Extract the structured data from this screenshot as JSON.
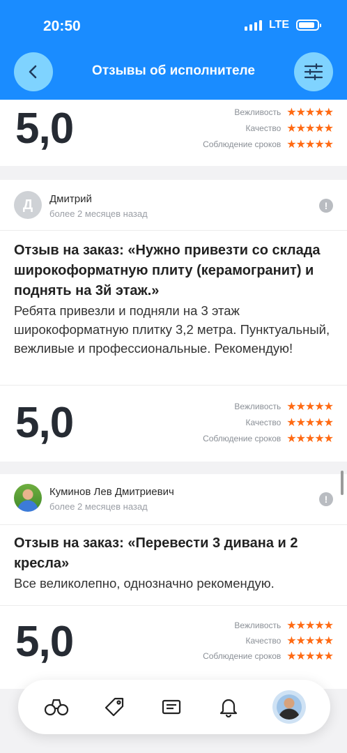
{
  "status_bar": {
    "time": "20:50",
    "network": "LTE"
  },
  "header": {
    "title": "Отзывы об исполнителе",
    "back_icon": "chevron-left-icon",
    "filter_icon": "sliders-icon"
  },
  "criteria_labels": [
    "Вежливость",
    "Качество",
    "Соблюдение сроков"
  ],
  "stars": "★★★★★",
  "accent_color": "#1a8cff",
  "star_color": "#ff6a13",
  "top_rating": {
    "score": "5,0"
  },
  "reviews": [
    {
      "avatar_letter": "Д",
      "author": "Дмитрий",
      "ago": "более 2 месяцев назад",
      "title": "Отзыв на заказ: «Нужно привезти со склада широкоформатную плиту (керамогранит) и поднять на 3й этаж.»",
      "text": "Ребята привезли и подняли на 3 этаж широкоформатную плитку 3,2 метра. Пунктуальный, вежливые и профессиональные. Рекомендую!",
      "score": "5,0"
    },
    {
      "avatar_letter": "",
      "author": "Куминов Лев Дмитриевич",
      "ago": "более 2 месяцев назад",
      "title": "Отзыв на заказ: «Перевести 3 дивана и 2 кресла»",
      "text": "Все великолепно, однозначно рекомендую.",
      "score": "5,0"
    }
  ],
  "bottom_nav": [
    "binoculars-icon",
    "tag-icon",
    "document-icon",
    "bell-icon",
    "profile-avatar"
  ]
}
